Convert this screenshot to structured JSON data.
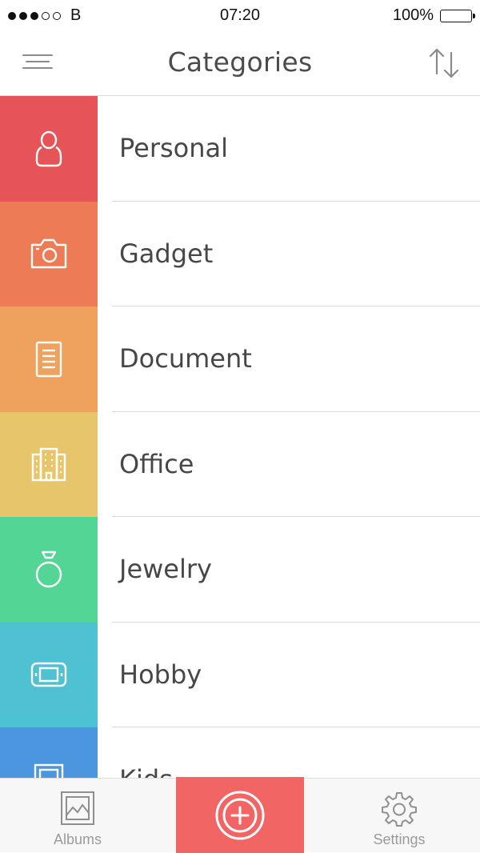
{
  "status_bar": {
    "carrier": "B",
    "time": "07:20",
    "battery": "100%"
  },
  "header": {
    "title": "Categories",
    "menu_icon": "hamburger-icon",
    "sort_icon": "sort-arrows-icon"
  },
  "categories": [
    {
      "label": "Personal",
      "icon": "person-icon",
      "color": "#e65457"
    },
    {
      "label": "Gadget",
      "icon": "camera-icon",
      "color": "#ed7b56"
    },
    {
      "label": "Document",
      "icon": "document-icon",
      "color": "#efa25e"
    },
    {
      "label": "Office",
      "icon": "building-icon",
      "color": "#e7c66b"
    },
    {
      "label": "Jewelry",
      "icon": "ring-icon",
      "color": "#53d595"
    },
    {
      "label": "Hobby",
      "icon": "game-console-icon",
      "color": "#4ec1d3"
    },
    {
      "label": "Kids",
      "icon": "frame-icon",
      "color": "#4c96df"
    }
  ],
  "tab_bar": {
    "albums_label": "Albums",
    "settings_label": "Settings",
    "add_color": "#f26565"
  }
}
